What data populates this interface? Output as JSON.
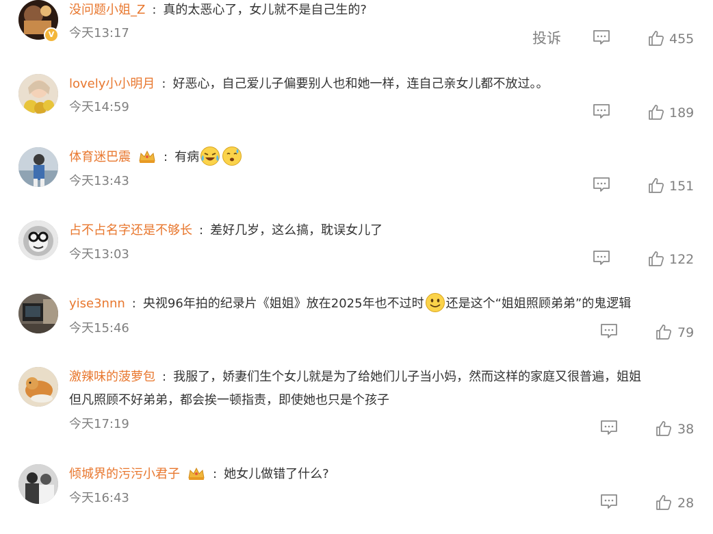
{
  "comments": [
    {
      "username": "没问题小姐_Z",
      "text": "真的太恶心了，女儿就不是自己生的?",
      "time": "今天13:17",
      "report": "投诉",
      "likes": "455"
    },
    {
      "username": "lovely小小明月",
      "text": "好恶心，自己爱儿子偏要别人也和她一样，连自己亲女儿都不放过。。",
      "time": "今天14:59",
      "likes": "189"
    },
    {
      "username": "体育迷巴震",
      "text": "有病",
      "time": "今天13:43",
      "likes": "151"
    },
    {
      "username": "占不占名字还是不够长",
      "text": "差好几岁，这么搞，耽误女儿了",
      "time": "今天13:03",
      "likes": "122"
    },
    {
      "username": "yise3nnn",
      "text_a": "央视96年拍的纪录片《姐姐》放在2025年也不过时",
      "text_b": "还是这个“姐姐照顾弟弟”的鬼逻辑",
      "time": "今天15:46",
      "likes": "79"
    },
    {
      "username": "激辣味的菠萝包",
      "text": "我服了，娇妻们生个女儿就是为了给她们儿子当小妈，然而这样的家庭又很普遍，姐姐",
      "text2": "但凡照顾不好弟弟，都会挨一顿指责，即使她也只是个孩子",
      "time": "今天17:19",
      "likes": "38"
    },
    {
      "username": "倾城界的污污小君子",
      "text": "她女儿做错了什么?",
      "time": "今天16:43",
      "likes": "28"
    }
  ],
  "colors": {
    "username": "#e8772e",
    "meta": "#808080",
    "text": "#333333"
  },
  "icons": {
    "reply": "comment-icon",
    "like": "thumbs-up-icon",
    "verified": "verified-badge-icon",
    "crown": "crown-badge-icon"
  }
}
